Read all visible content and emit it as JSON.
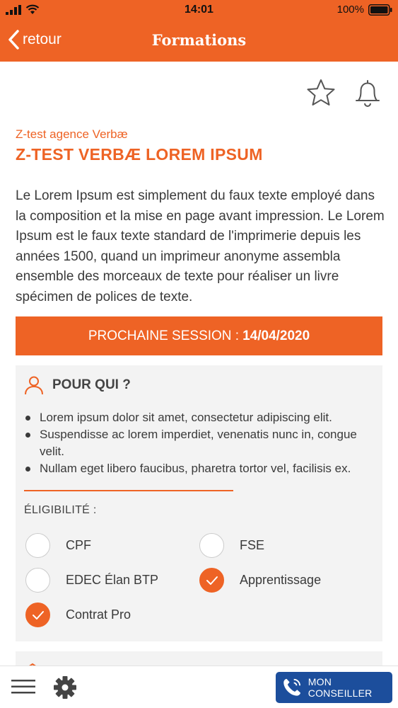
{
  "status": {
    "time": "14:01",
    "battery": "100%"
  },
  "nav": {
    "back_label": "retour",
    "title": "Formations"
  },
  "course": {
    "agency": "Z-test agence Verbæ",
    "title": "Z-TEST VERBÆ LOREM IPSUM",
    "description": "Le Lorem Ipsum est simplement du faux texte employé dans la composition et la mise en page avant impression. Le Lorem Ipsum est le faux texte standard de l'imprimerie depuis les années 1500, quand un imprimeur anonyme assembla ensemble des morceaux de texte pour réaliser un livre spécimen de polices de texte."
  },
  "session": {
    "label": "PROCHAINE SESSION :",
    "date": "14/04/2020"
  },
  "audience": {
    "title": "POUR QUI ?",
    "bullets": [
      "Lorem ipsum dolor sit amet, consectetur adipiscing elit.",
      "Suspendisse ac lorem imperdiet, venenatis nunc in, congue velit.",
      "Nullam eget libero faucibus, pharetra tortor vel, facilisis ex."
    ],
    "eligibility_label": "ÉLIGIBILITÉ :",
    "options": [
      {
        "label": "CPF",
        "checked": false
      },
      {
        "label": "FSE",
        "checked": false
      },
      {
        "label": "EDEC Élan BTP",
        "checked": false
      },
      {
        "label": "Apprentissage",
        "checked": true
      },
      {
        "label": "Contrat Pro",
        "checked": true
      }
    ]
  },
  "bottom": {
    "advisor_label": "MON CONSEILLER"
  },
  "colors": {
    "accent": "#ee6325",
    "advisor_button": "#1c4e9c"
  }
}
